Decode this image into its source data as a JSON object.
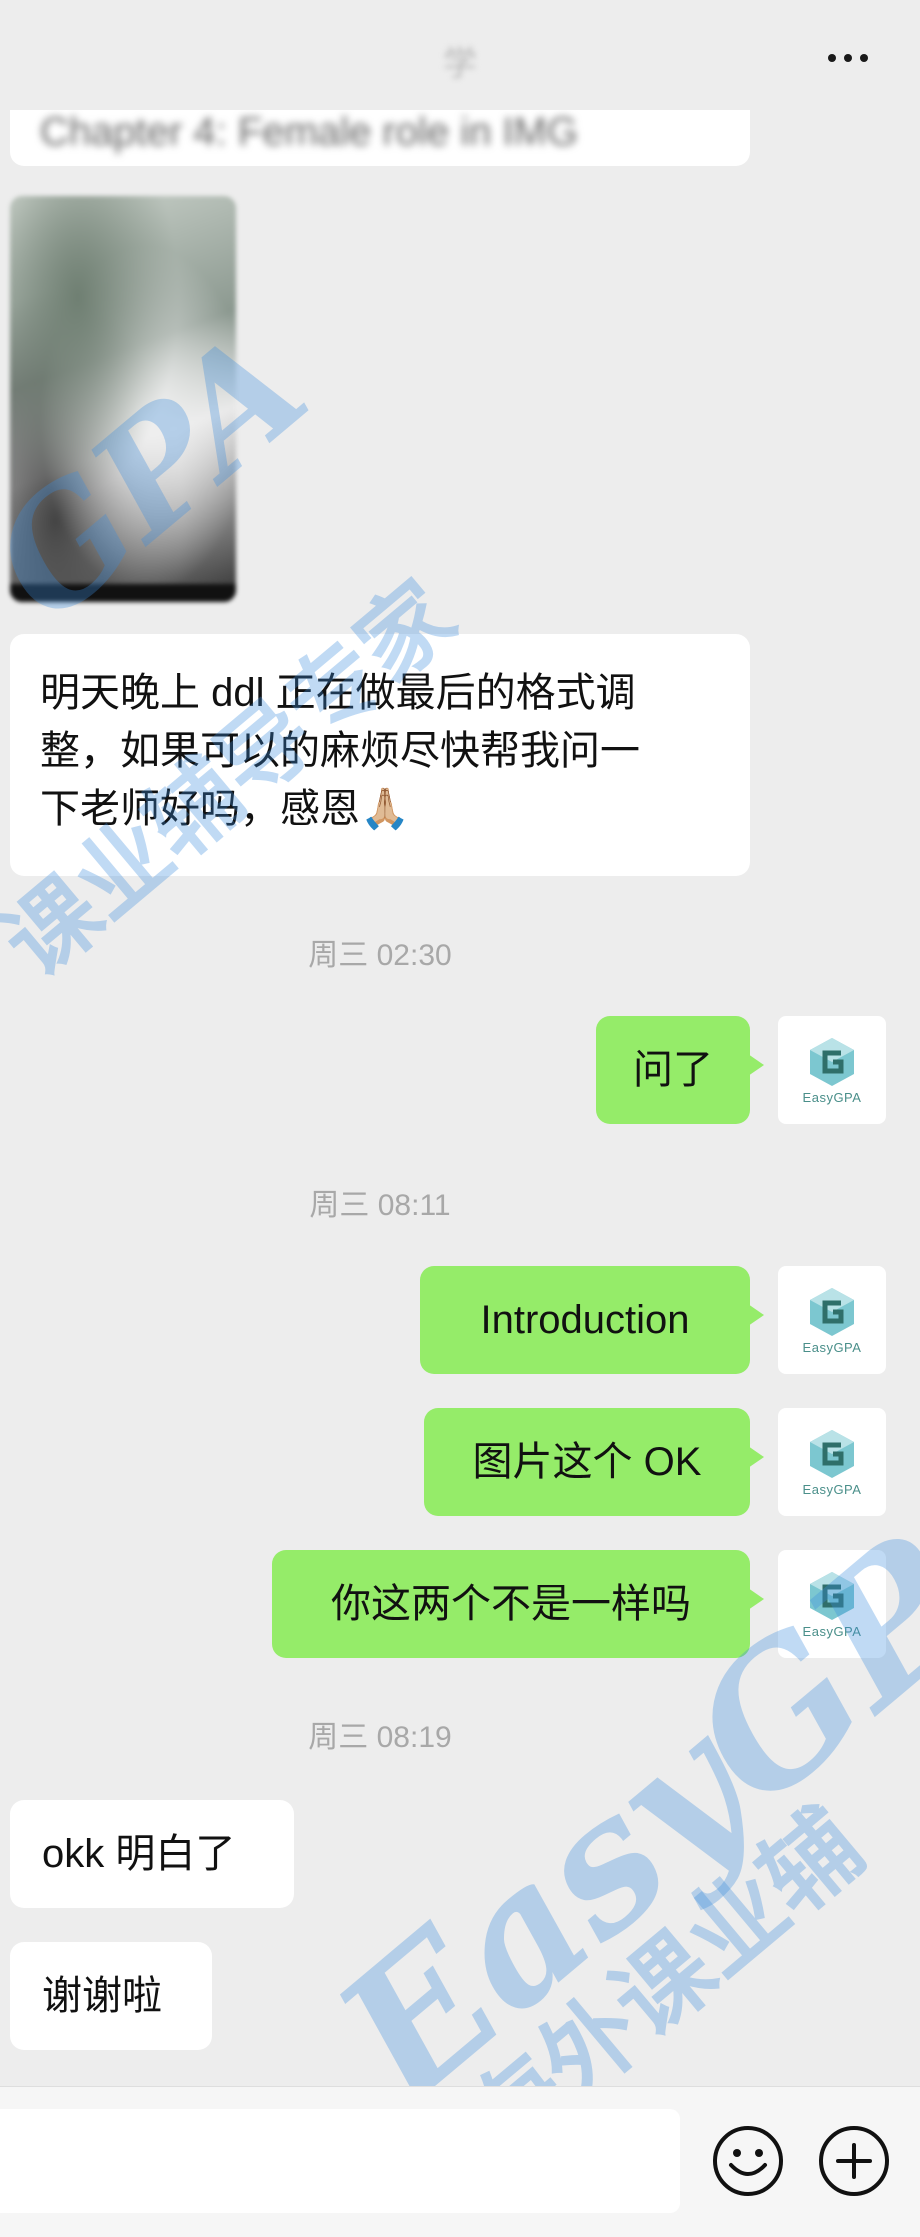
{
  "header": {
    "title": "学",
    "more_icon": "more-horizontal-icon"
  },
  "messages": {
    "quoted_blurred": "Chapter 4: Female role in IMG",
    "incoming_1": [
      "明天晚上 ddl 正在做最后的格式调",
      "整，如果可以的麻烦尽快帮我问一",
      "下老师好吗，感恩🙏🏼"
    ],
    "time_1": "周三 02:30",
    "outgoing_1": "问了",
    "time_2": "周三 08:11",
    "outgoing_2": "Introduction",
    "outgoing_3": "图片这个 OK",
    "outgoing_4": "你这两个不是一样吗",
    "time_3": "周三 08:19",
    "incoming_2": "okk 明白了",
    "incoming_3": "谢谢啦"
  },
  "avatar": {
    "caption": "EasyGPA",
    "icon": "easygpa-logo-icon",
    "color": "#4a8f8a"
  },
  "watermarks": {
    "line_1": "GPA",
    "line_2": "课业辅导专家",
    "line_3": "EasyGP",
    "line_4": "海外课业辅"
  },
  "input_bar": {
    "emoji_icon": "emoji-icon",
    "plus_icon": "plus-circle-icon"
  },
  "colors": {
    "background": "#ededed",
    "outgoing_bubble": "#95ec69",
    "incoming_bubble": "#ffffff",
    "timestamp": "#a8a8a8"
  }
}
